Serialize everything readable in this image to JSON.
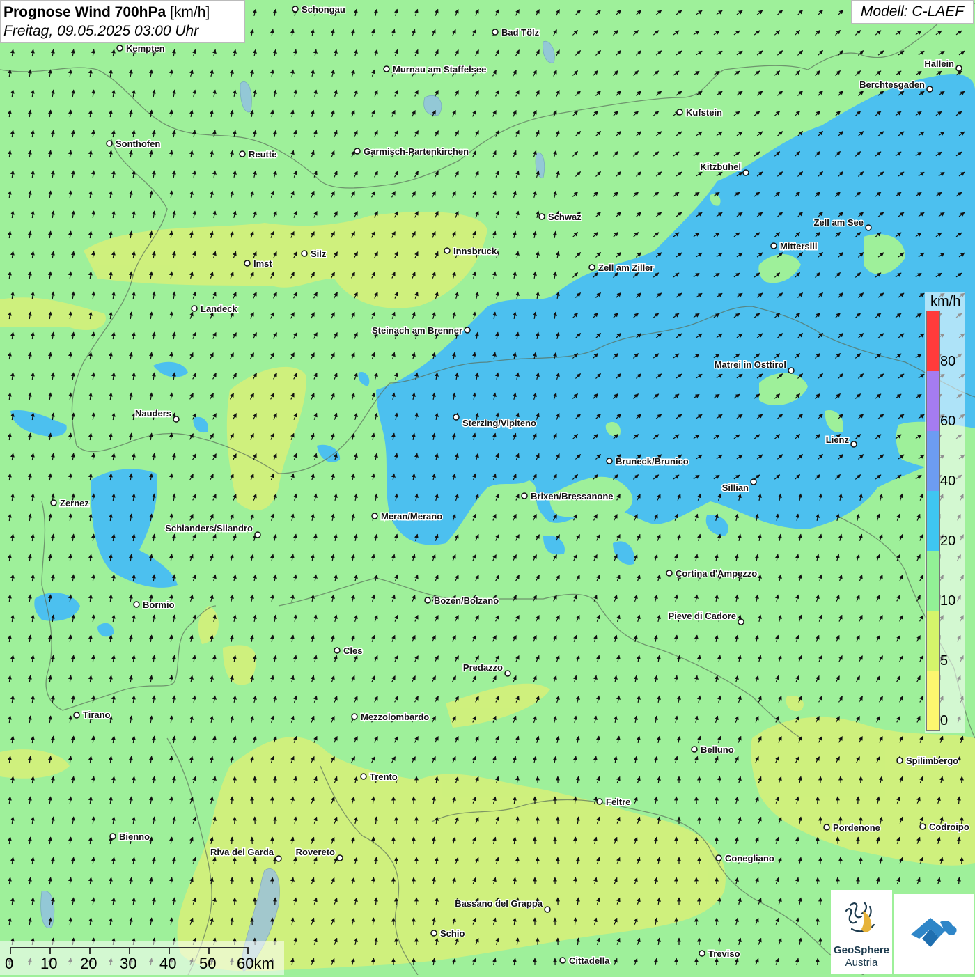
{
  "title": {
    "main": "Prognose Wind 700hPa",
    "unit": "[km/h]",
    "date": "Freitag, 09.05.2025 03:00 Uhr"
  },
  "model": "Modell: C-LAEF",
  "legend": {
    "unit": "km/h",
    "labels": [
      "80",
      "60",
      "40",
      "20",
      "10",
      "5",
      "0"
    ],
    "colors": [
      "#ff3b3b",
      "#a57cf0",
      "#6d9cf2",
      "#3fc6f2",
      "#92f196",
      "#d5f56b",
      "#fcf66f"
    ]
  },
  "scalebar": {
    "labels": [
      "0",
      "10",
      "20",
      "30",
      "40",
      "50",
      "60km"
    ]
  },
  "logo": {
    "line1": "GeoSphere",
    "line2": "Austria"
  },
  "colors": {
    "zone_0_5": "#eef06e",
    "zone_5_10": "#d4f07a",
    "zone_10_20": "#9ef09a",
    "zone_20_40": "#4cc0ef"
  },
  "wind_direction": "mostly north-northeast (southwesterly flow)",
  "cities": [
    "Schongau",
    "Bad Tölz",
    "Kempten",
    "Murnau am Staffelsee",
    "Hallein",
    "Berchtesgaden",
    "Kufstein",
    "Sonthofen",
    "Reutte",
    "Garmisch-Partenkirchen",
    "Kitzbühel",
    "Schwaz",
    "Zell am See",
    "Mittersill",
    "Innsbruck",
    "Silz",
    "Imst",
    "Zell am Ziller",
    "Landeck",
    "Steinach am Brenner",
    "Matrei in Osttirol",
    "Nauders",
    "Sterzing/Vipiteno",
    "Lienz",
    "Bruneck/Brunico",
    "Sillian",
    "Brixen/Bressanone",
    "Zernez",
    "Meran/Merano",
    "Schlanders/Silandro",
    "Cortina d'Ampezzo",
    "Bormio",
    "Bozen/Bolzano",
    "Pieve di Cadore",
    "Cles",
    "Predazzo",
    "Tirano",
    "Mezzolombardo",
    "Belluno",
    "Spilimbergo",
    "Trento",
    "Feltre",
    "Pordenone",
    "Codroipo",
    "Bienno",
    "Riva del Garda",
    "Rovereto",
    "Conegliano",
    "Bassano del Grappa",
    "Schio",
    "Treviso",
    "Cittadella"
  ]
}
